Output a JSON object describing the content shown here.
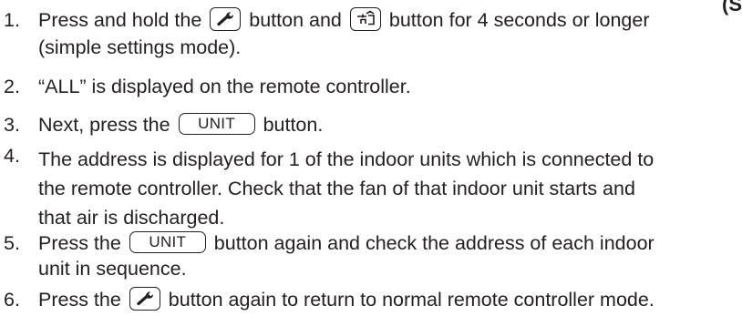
{
  "corner_fragment": "(S",
  "unit_key_label": "UNIT",
  "icons": {
    "wrench": "wrench-icon",
    "return": "return-arrow-icon"
  },
  "steps": [
    {
      "number": "1.",
      "line1_a": "Press and hold the",
      "line1_b": "button and",
      "line1_c": "button for 4 seconds or longer",
      "line2": "(simple settings mode)."
    },
    {
      "number": "2.",
      "text": "“ALL” is displayed on the remote controller."
    },
    {
      "number": "3.",
      "text_a": "Next, press the",
      "text_b": "button."
    },
    {
      "number": "4.",
      "line1": "The address is displayed for 1 of the indoor units which is connected to",
      "line2": "the remote controller. Check that the fan of that indoor unit starts and",
      "line3": "that air is discharged."
    },
    {
      "number": "5.",
      "line1_a": "Press the",
      "line1_b": "button again and check the address of each indoor",
      "line2": "unit in sequence."
    },
    {
      "number": "6.",
      "text_a": "Press the",
      "text_b": "button again to return to normal remote controller mode."
    }
  ]
}
